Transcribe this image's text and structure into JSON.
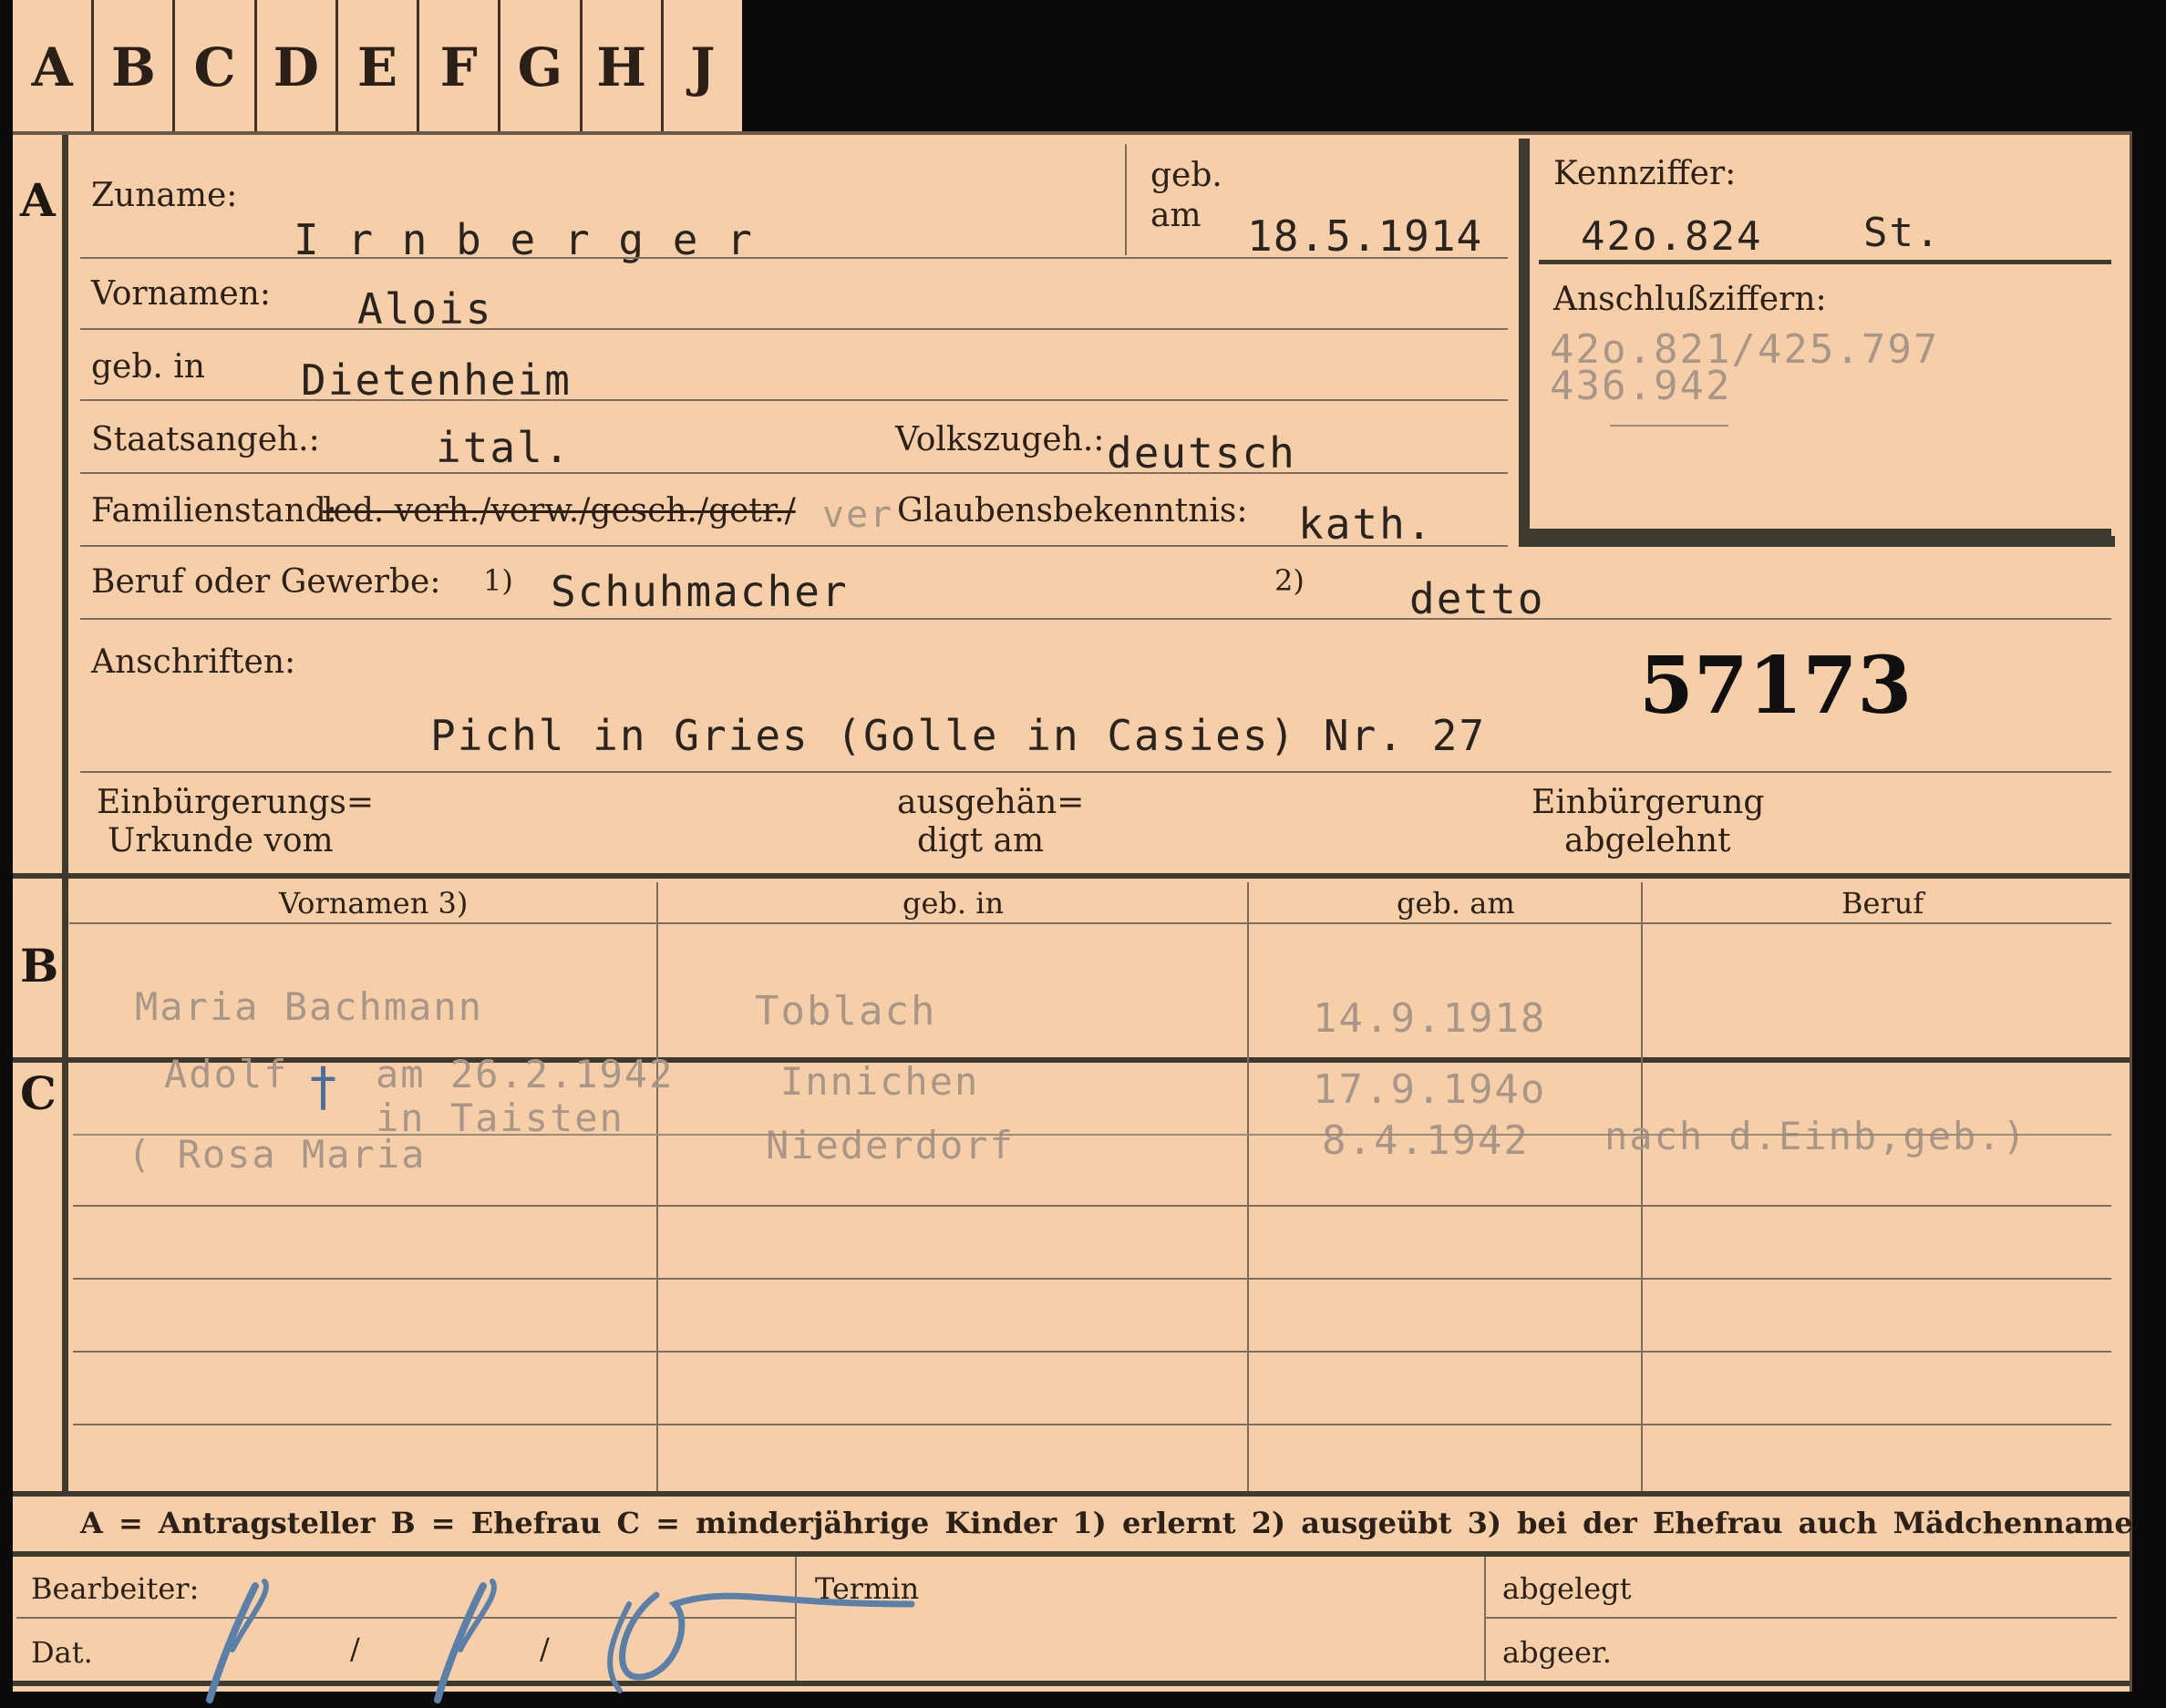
{
  "tabs": [
    "A",
    "B",
    "C",
    "D",
    "E",
    "F",
    "G",
    "H",
    "J"
  ],
  "section_a": {
    "marker": "A",
    "zuname_label": "Zuname:",
    "zuname_value": "I r n b e r g e r",
    "geb_label_1": "geb.",
    "geb_label_2": "am",
    "geb_value": "18.5.1914",
    "kennziffer_label": "Kennziffer:",
    "kennziffer_value": "42o.824",
    "kennziffer_suffix": "St.",
    "anschluss_label": "Anschlußziffern:",
    "anschluss_line1": "42o.821/425.797",
    "anschluss_line2": "436.942",
    "vornamen_label": "Vornamen:",
    "vornamen_value": "Alois",
    "gebin_label": "geb. in",
    "gebin_value": "Dietenheim",
    "staats_label": "Staatsangeh.:",
    "staats_value": "ital.",
    "volks_label": "Volkszugeh.:",
    "volks_value": "deutsch",
    "familien_label": "Familienstand:",
    "familien_options": "led. verh./verw./gesch./getr./",
    "familien_extra": "ver",
    "glauben_label": "Glaubensbekenntnis:",
    "glauben_value": "kath.",
    "beruf_label": "Beruf oder Gewerbe:",
    "beruf_mark1": "1)",
    "beruf_value1": "Schuhmacher",
    "beruf_mark2": "2)",
    "beruf_value2": "detto",
    "anschriften_label": "Anschriften:",
    "anschriften_value": "Pichl in Gries (Golle in Casies) Nr. 27",
    "stamp_number": "57173",
    "einb_urkunde_1": "Einbürgerungs=",
    "einb_urkunde_2": "Urkunde vom",
    "ausgeh_1": "ausgehän=",
    "ausgeh_2": "digt am",
    "einb_abgel_1": "Einbürgerung",
    "einb_abgel_2": "abgelehnt"
  },
  "table": {
    "headers": [
      "Vornamen 3)",
      "geb. in",
      "geb. am",
      "Beruf"
    ],
    "section_b_marker": "B",
    "section_c_marker": "C",
    "wife": {
      "name": "Maria Bachmann",
      "place": "Toblach",
      "date": "14.9.1918"
    },
    "children": [
      {
        "name": "Adolf",
        "note": "am 26.2.1942",
        "note2": "in Taisten",
        "place": "Innichen",
        "date": "17.9.194o"
      },
      {
        "name": "( Rosa Maria",
        "place": "Niederdorf",
        "date": "8.4.1942",
        "remark": "nach d.Einb,geb.)"
      }
    ]
  },
  "legend": "A = Antragsteller   B = Ehefrau   C = minderjährige Kinder   1) erlernt   2) ausgeübt   3) bei der Ehefrau auch Mädchenname",
  "footer": {
    "bearbeiter_label": "Bearbeiter:",
    "dat_label": "Dat.",
    "dat_sep1": "/",
    "dat_sep2": "/",
    "termin_label": "Termin",
    "abgelegt_label": "abgelegt",
    "abgeer_label": "abgeer."
  },
  "colors": {
    "card": "#f6cfa8",
    "ink": "#2c2118",
    "faint_ink": "#a89788",
    "pen": "#5a7fa8"
  }
}
